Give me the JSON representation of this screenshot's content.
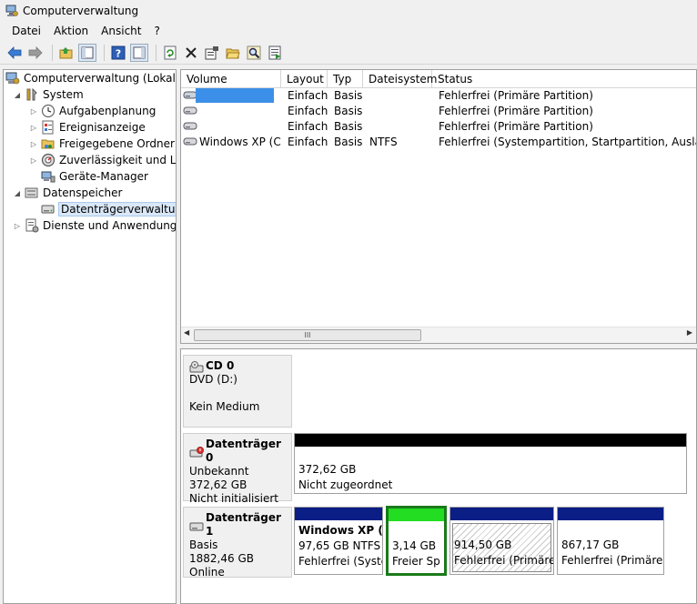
{
  "window": {
    "title": "Computerverwaltung"
  },
  "menu": [
    "Datei",
    "Aktion",
    "Ansicht",
    "?"
  ],
  "toolbar": [
    "back-icon",
    "forward-icon",
    "up-icon",
    "show-hide-tree-icon",
    "help-icon",
    "properties-pane-icon",
    "refresh-icon",
    "delete-icon",
    "properties-icon",
    "open-icon",
    "search-icon",
    "export-icon"
  ],
  "tree": [
    {
      "label": "Computerverwaltung (Lokal)",
      "icon": "computer-icon"
    },
    {
      "label": "System",
      "icon": "tools-icon"
    },
    {
      "label": "Aufgabenplanung",
      "icon": "clock-icon"
    },
    {
      "label": "Ereignisanzeige",
      "icon": "event-viewer-icon"
    },
    {
      "label": "Freigegebene Ordner",
      "icon": "shared-folder-icon"
    },
    {
      "label": "Zuverlässigkeit und Leis",
      "icon": "performance-icon"
    },
    {
      "label": "Geräte-Manager",
      "icon": "device-manager-icon"
    },
    {
      "label": "Datenspeicher",
      "icon": "storage-icon"
    },
    {
      "label": "Datenträgerverwaltung",
      "icon": "disk-management-icon"
    },
    {
      "label": "Dienste und Anwendungen",
      "icon": "services-icon"
    }
  ],
  "volumes": {
    "headers": [
      "Volume",
      "Layout",
      "Typ",
      "Dateisystem",
      "Status"
    ],
    "rows": [
      {
        "volume": "",
        "layout": "Einfach",
        "typ": "Basis",
        "fs": "",
        "status": "Fehlerfrei (Primäre Partition)"
      },
      {
        "volume": "",
        "layout": "Einfach",
        "typ": "Basis",
        "fs": "",
        "status": "Fehlerfrei (Primäre Partition)"
      },
      {
        "volume": "",
        "layout": "Einfach",
        "typ": "Basis",
        "fs": "",
        "status": "Fehlerfrei (Primäre Partition)"
      },
      {
        "volume": "Windows XP (C:)",
        "layout": "Einfach",
        "typ": "Basis",
        "fs": "NTFS",
        "status": "Fehlerfrei (Systempartition, Startpartition, Auslagerun"
      }
    ],
    "scroll_grip": "III"
  },
  "disks": {
    "cd0": {
      "title": "CD 0",
      "line1": "DVD (D:)",
      "line2": "",
      "line3": "Kein Medium"
    },
    "disk0": {
      "title": "Datenträger 0",
      "line1": "Unbekannt",
      "line2": "372,62 GB",
      "line3": "Nicht initialisiert",
      "part": {
        "size": "372,62 GB",
        "status": "Nicht zugeordnet"
      }
    },
    "disk1": {
      "title": "Datenträger 1",
      "line1": "Basis",
      "line2": "1882,46 GB",
      "line3": "Online",
      "parts": [
        {
          "name": "Windows XP  (C",
          "size": "97,65 GB NTFS",
          "status": "Fehlerfrei (Syste"
        },
        {
          "name": "",
          "size": "3,14 GB",
          "status": "Freier Sp"
        },
        {
          "name": "",
          "size": "914,50 GB",
          "status": "Fehlerfrei (Primäre P"
        },
        {
          "name": "",
          "size": "867,17 GB",
          "status": "Fehlerfrei (Primäre P"
        }
      ]
    }
  },
  "colors": {
    "primary_partition": "#0a1e86",
    "free_space": "#22dd22",
    "unallocated": "#000000",
    "selection_border": "#1a7a1a",
    "redacted": "#3c8fe8"
  }
}
